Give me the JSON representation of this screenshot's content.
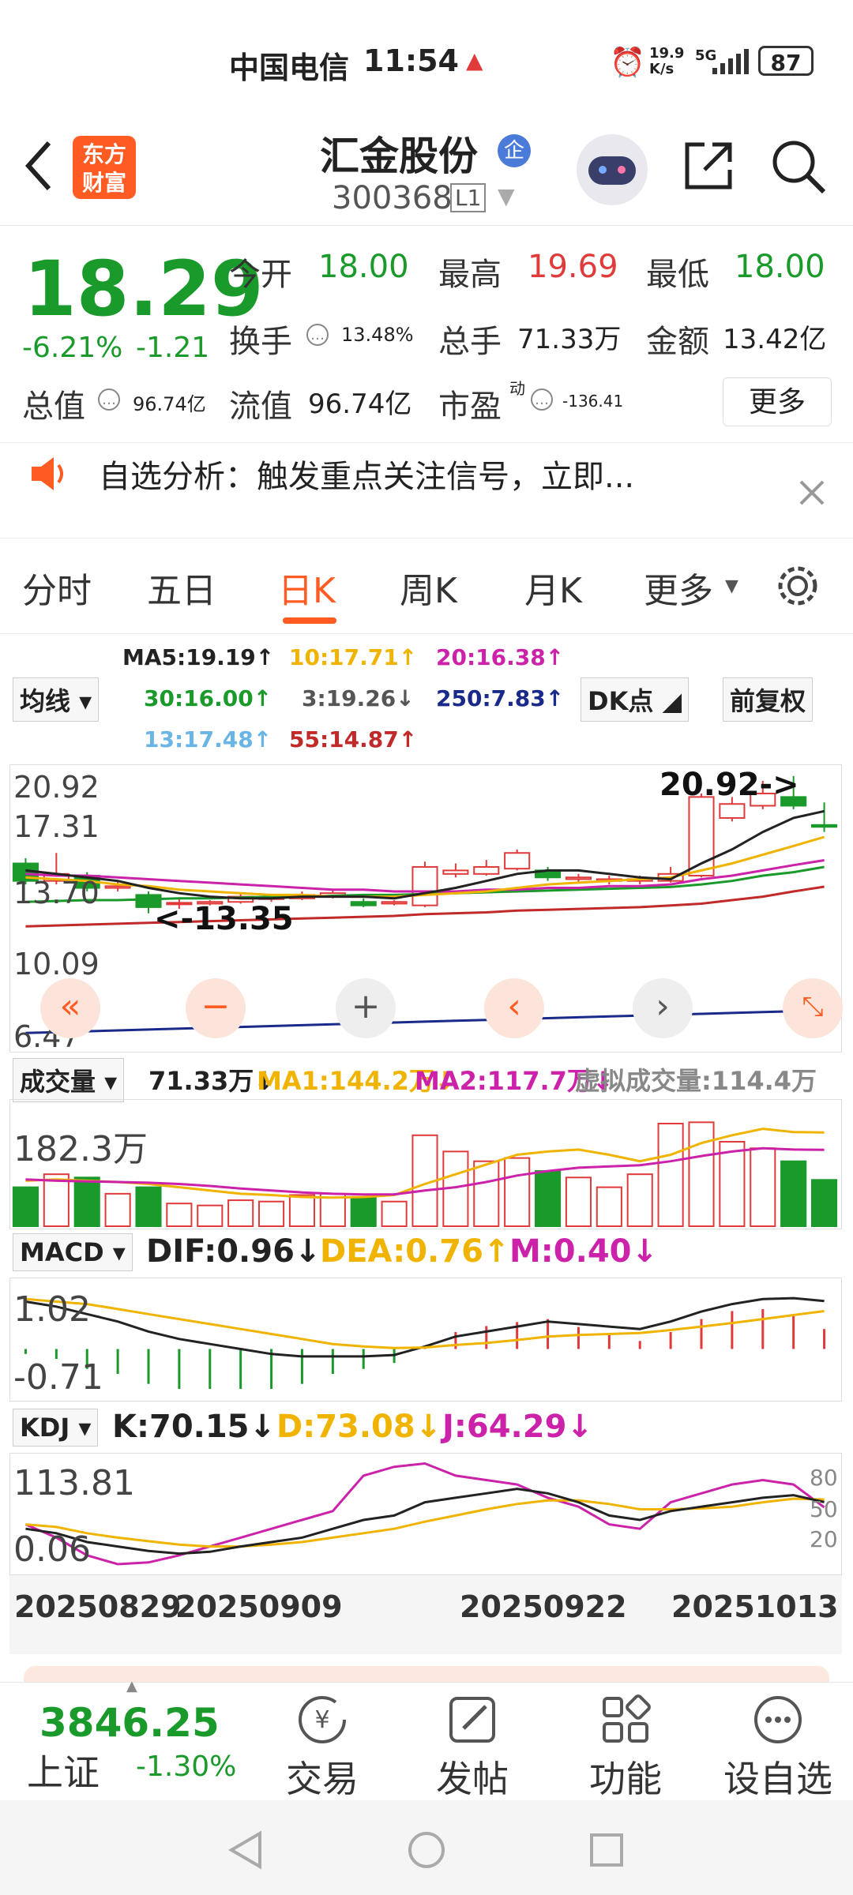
{
  "status_bar": {
    "carrier": "中国电信",
    "time": "11:54",
    "net_speed_top": "19.9",
    "net_speed_bottom": "K/s",
    "network": "5G",
    "battery": "87"
  },
  "header": {
    "logo_text_1": "东方",
    "logo_text_2": "财富",
    "stock_name": "汇金股份",
    "badge": "企",
    "stock_code": "300368",
    "level": "L1"
  },
  "quote": {
    "price": "18.29",
    "change_pct": "-6.21%",
    "change_amt": "-1.21",
    "open_label": "今开",
    "open": "18.00",
    "high_label": "最高",
    "high": "19.69",
    "low_label": "最低",
    "low": "18.00",
    "turnover_label": "换手",
    "turnover": "13.48%",
    "volume_label": "总手",
    "volume": "71.33万",
    "amount_label": "金额",
    "amount": "13.42亿",
    "mktcap_label": "总值",
    "mktcap": "96.74亿",
    "float_label": "流值",
    "float": "96.74亿",
    "pe_label": "市盈",
    "pe_sup": "动",
    "pe": "-136.41",
    "more_btn": "更多"
  },
  "notice": {
    "text": "自选分析：触发重点关注信号，立即..."
  },
  "tabs": [
    "分时",
    "五日",
    "日K",
    "周K",
    "月K",
    "更多"
  ],
  "ma_legend": {
    "dropdown": "均线",
    "ma5": "MA5:19.19↑",
    "ma10": "10:17.71↑",
    "ma20": "20:16.38↑",
    "ma30": "30:16.00↑",
    "ma3": "3:19.26↓",
    "ma250": "250:7.83↑",
    "ma13": "13:17.48↑",
    "ma55": "55:14.87↑",
    "dk_btn": "DK点",
    "adj_btn": "前复权"
  },
  "kline_axis": [
    "20.92",
    "17.31",
    "13.70",
    "10.09",
    "6.47"
  ],
  "kline_annotations": {
    "high_mark": "20.92->",
    "low_mark": "<-13.35"
  },
  "volume": {
    "dropdown": "成交量",
    "vol": "71.33万↓",
    "ma1": "MA1:144.2万↓",
    "ma2": "MA2:117.7万↓",
    "virtual": "虚拟成交量:114.4万",
    "axis_max": "182.3万"
  },
  "macd": {
    "dropdown": "MACD",
    "dif": "DIF:0.96↓",
    "dea": "DEA:0.76↑",
    "m": "M:0.40↓",
    "axis_top": "1.02",
    "axis_bot": "-0.71"
  },
  "kdj": {
    "dropdown": "KDJ",
    "k": "K:70.15↓",
    "d": "D:73.08↓",
    "j": "J:64.29↓",
    "axis_top": "113.81",
    "axis_bot": "0.06",
    "lvl80": "80",
    "lvl50": "50",
    "lvl20": "20"
  },
  "dates": [
    "20250829",
    "20250909",
    "20250922",
    "20251013"
  ],
  "bottom_bar": {
    "index_value": "3846.25",
    "index_name": "上证",
    "index_change": "-1.30%",
    "trade": "交易",
    "post": "发帖",
    "func": "功能",
    "add_watch": "设自选"
  },
  "colors": {
    "up": "#e03a3a",
    "down": "#1a9a2a",
    "accent": "#ff5b22",
    "ma5": "#222222",
    "ma10": "#f0b400",
    "ma20": "#cc22aa"
  },
  "chart_data": {
    "type": "candlestick",
    "ylim": [
      6.47,
      20.92
    ],
    "candles": [
      {
        "o": 16.2,
        "c": 15.2,
        "h": 16.5,
        "l": 15.0
      },
      {
        "o": 15.2,
        "c": 15.6,
        "h": 16.8,
        "l": 15.0
      },
      {
        "o": 15.5,
        "c": 14.8,
        "h": 15.7,
        "l": 14.6
      },
      {
        "o": 14.8,
        "c": 14.9,
        "h": 15.2,
        "l": 14.6
      },
      {
        "o": 14.4,
        "c": 13.7,
        "h": 14.6,
        "l": 13.35
      },
      {
        "o": 13.9,
        "c": 13.95,
        "h": 14.2,
        "l": 13.6
      },
      {
        "o": 13.9,
        "c": 14.0,
        "h": 14.1,
        "l": 13.8
      },
      {
        "o": 14.0,
        "c": 14.3,
        "h": 14.5,
        "l": 13.9
      },
      {
        "o": 14.2,
        "c": 14.25,
        "h": 14.4,
        "l": 14.0
      },
      {
        "o": 14.2,
        "c": 14.4,
        "h": 14.6,
        "l": 14.1
      },
      {
        "o": 14.3,
        "c": 14.5,
        "h": 14.7,
        "l": 14.2
      },
      {
        "o": 14.0,
        "c": 13.8,
        "h": 14.2,
        "l": 13.7
      },
      {
        "o": 13.9,
        "c": 14.0,
        "h": 14.1,
        "l": 13.8
      },
      {
        "o": 13.8,
        "c": 16.0,
        "h": 16.3,
        "l": 13.7
      },
      {
        "o": 15.6,
        "c": 15.8,
        "h": 16.2,
        "l": 15.4
      },
      {
        "o": 15.6,
        "c": 16.0,
        "h": 16.4,
        "l": 15.5
      },
      {
        "o": 15.9,
        "c": 16.8,
        "h": 17.0,
        "l": 15.8
      },
      {
        "o": 15.8,
        "c": 15.4,
        "h": 16.0,
        "l": 15.2
      },
      {
        "o": 15.3,
        "c": 15.4,
        "h": 15.6,
        "l": 15.1
      },
      {
        "o": 15.2,
        "c": 15.3,
        "h": 15.5,
        "l": 15.0
      },
      {
        "o": 15.2,
        "c": 15.3,
        "h": 15.5,
        "l": 15.0
      },
      {
        "o": 15.2,
        "c": 15.6,
        "h": 16.0,
        "l": 15.1
      },
      {
        "o": 15.5,
        "c": 20.0,
        "h": 20.2,
        "l": 15.4
      },
      {
        "o": 18.8,
        "c": 19.6,
        "h": 20.0,
        "l": 18.6
      },
      {
        "o": 19.5,
        "c": 20.2,
        "h": 20.92,
        "l": 19.3
      },
      {
        "o": 20.0,
        "c": 19.5,
        "h": 21.2,
        "l": 19.3
      },
      {
        "o": 18.4,
        "c": 18.29,
        "h": 19.69,
        "l": 18.0
      }
    ],
    "ma5": [
      15.8,
      15.6,
      15.4,
      15.2,
      14.8,
      14.5,
      14.3,
      14.2,
      14.2,
      14.3,
      14.3,
      14.3,
      14.2,
      14.5,
      14.8,
      15.2,
      15.6,
      15.8,
      15.8,
      15.6,
      15.4,
      15.3,
      16.2,
      17.0,
      18.0,
      18.8,
      19.19
    ],
    "ma10": [
      15.4,
      15.3,
      15.2,
      15.0,
      14.9,
      14.7,
      14.6,
      14.5,
      14.4,
      14.4,
      14.3,
      14.3,
      14.3,
      14.4,
      14.5,
      14.6,
      14.8,
      15.0,
      15.1,
      15.2,
      15.3,
      15.4,
      15.8,
      16.2,
      16.7,
      17.2,
      17.71
    ],
    "ma20": [
      15.6,
      15.5,
      15.5,
      15.4,
      15.3,
      15.2,
      15.1,
      15.0,
      14.9,
      14.8,
      14.7,
      14.7,
      14.6,
      14.6,
      14.6,
      14.7,
      14.7,
      14.8,
      14.8,
      14.9,
      14.9,
      15.0,
      15.3,
      15.5,
      15.8,
      16.1,
      16.38
    ],
    "ma30": [
      14.0,
      14.05,
      14.1,
      14.1,
      14.15,
      14.2,
      14.2,
      14.25,
      14.3,
      14.3,
      14.35,
      14.4,
      14.4,
      14.45,
      14.5,
      14.55,
      14.6,
      14.65,
      14.7,
      14.75,
      14.8,
      14.85,
      15.0,
      15.2,
      15.5,
      15.7,
      16.0
    ],
    "ma55": [
      12.6,
      12.65,
      12.7,
      12.75,
      12.8,
      12.85,
      12.9,
      12.95,
      13.0,
      13.05,
      13.1,
      13.15,
      13.2,
      13.3,
      13.35,
      13.4,
      13.5,
      13.55,
      13.6,
      13.65,
      13.7,
      13.8,
      13.9,
      14.1,
      14.3,
      14.6,
      14.87
    ],
    "ma250": [
      6.5,
      6.55,
      6.6,
      6.65,
      6.7,
      6.75,
      6.8,
      6.85,
      6.9,
      6.95,
      7.0,
      7.05,
      7.1,
      7.15,
      7.2,
      7.25,
      7.3,
      7.35,
      7.4,
      7.45,
      7.5,
      7.55,
      7.6,
      7.65,
      7.7,
      7.75,
      7.83
    ],
    "volumes": [
      60,
      80,
      75,
      50,
      60,
      35,
      32,
      40,
      38,
      48,
      50,
      45,
      38,
      140,
      115,
      100,
      105,
      85,
      75,
      60,
      80,
      158,
      160,
      130,
      120,
      100,
      71.33
    ],
    "vol_ma1": [
      70,
      72,
      70,
      68,
      65,
      60,
      55,
      50,
      48,
      45,
      44,
      45,
      48,
      65,
      80,
      95,
      110,
      115,
      118,
      110,
      100,
      110,
      128,
      140,
      150,
      145,
      144.2
    ],
    "vol_ma2": [
      72,
      70,
      69,
      68,
      67,
      65,
      62,
      58,
      55,
      52,
      50,
      49,
      49,
      55,
      60,
      68,
      78,
      85,
      90,
      92,
      94,
      100,
      108,
      115,
      120,
      118,
      117.7
    ],
    "dif": [
      0.95,
      0.85,
      0.7,
      0.55,
      0.35,
      0.2,
      0.1,
      0.0,
      -0.1,
      -0.15,
      -0.15,
      -0.15,
      -0.12,
      0.05,
      0.25,
      0.35,
      0.45,
      0.55,
      0.5,
      0.45,
      0.4,
      0.55,
      0.75,
      0.9,
      1.0,
      1.02,
      0.96
    ],
    "dea": [
      1.0,
      0.95,
      0.9,
      0.8,
      0.7,
      0.6,
      0.5,
      0.4,
      0.3,
      0.2,
      0.1,
      0.05,
      0.02,
      0.03,
      0.08,
      0.12,
      0.18,
      0.25,
      0.28,
      0.3,
      0.32,
      0.38,
      0.45,
      0.52,
      0.6,
      0.68,
      0.76
    ],
    "k": [
      40,
      35,
      25,
      20,
      15,
      12,
      14,
      20,
      25,
      30,
      40,
      50,
      55,
      70,
      75,
      80,
      85,
      80,
      70,
      55,
      50,
      60,
      65,
      70,
      75,
      78,
      70.15
    ],
    "d": [
      45,
      42,
      35,
      30,
      26,
      22,
      20,
      20,
      22,
      25,
      30,
      35,
      40,
      48,
      55,
      62,
      68,
      72,
      72,
      68,
      62,
      62,
      63,
      65,
      70,
      74,
      73.08
    ],
    "j": [
      45,
      30,
      10,
      0,
      2,
      10,
      20,
      30,
      40,
      50,
      60,
      100,
      110,
      113.81,
      100,
      95,
      90,
      75,
      65,
      45,
      40,
      70,
      80,
      90,
      95,
      90,
      64.29
    ]
  }
}
